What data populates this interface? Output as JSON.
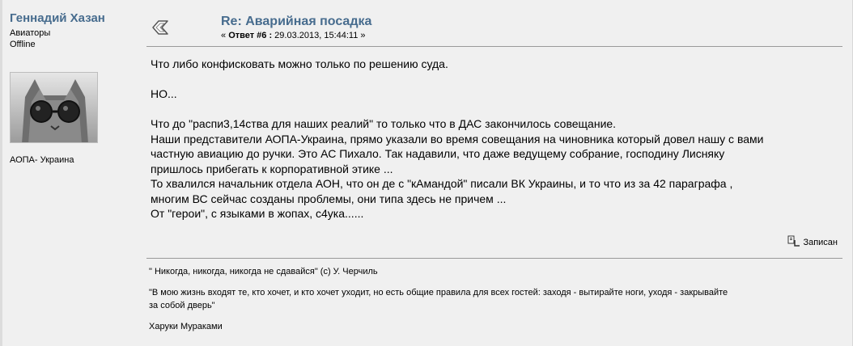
{
  "poster": {
    "name": "Геннадий Хазан",
    "group": "Авиаторы",
    "status": "Offline",
    "personal_text": "АОПА- Украина"
  },
  "post": {
    "subject": "Re: Аварийная посадка",
    "meta_prefix": "« ",
    "reply_label": "Ответ #6 :",
    "date": " 29.03.2013, 15:44:11 »",
    "body": [
      "Что либо конфисковать можно только по решению суда.",
      "",
      "НО...",
      "",
      "Что до \"распи3,14ства для наших реалий\" то только что в ДАС закончилось совещание.",
      "Наши представители АОПА-Украина, прямо указали во время совещания на чиновника который довел нашу с вами",
      "частную авиацию до ручки. Это АС Пихало. Так надавили, что даже ведущему собрание, господину Лисняку",
      "пришлось прибегать к корпоративной этике ...",
      "То хвалился начальник отдела АОН, что он де с \"кАмандой\" писали ВК Украины, и то что из за 42 параграфа ,",
      "многим ВС сейчас созданы проблемы, они типа здесь не причем ...",
      "От \"герои\", с языками в жопах, с4ука......"
    ],
    "recorded_label": "Записан"
  },
  "signature": {
    "lines": [
      "\" Никогда, никогда, никогда не сдавайся\" (с) У. Черчиль",
      "",
      "\"В мою жизнь входят те, кто хочет, и кто хочет уходит, но есть общие правила для всех гостей: заходя - вытирайте ноги, уходя - закрывайте",
      "за собой дверь\"",
      "",
      "Харуки Мураками"
    ]
  }
}
